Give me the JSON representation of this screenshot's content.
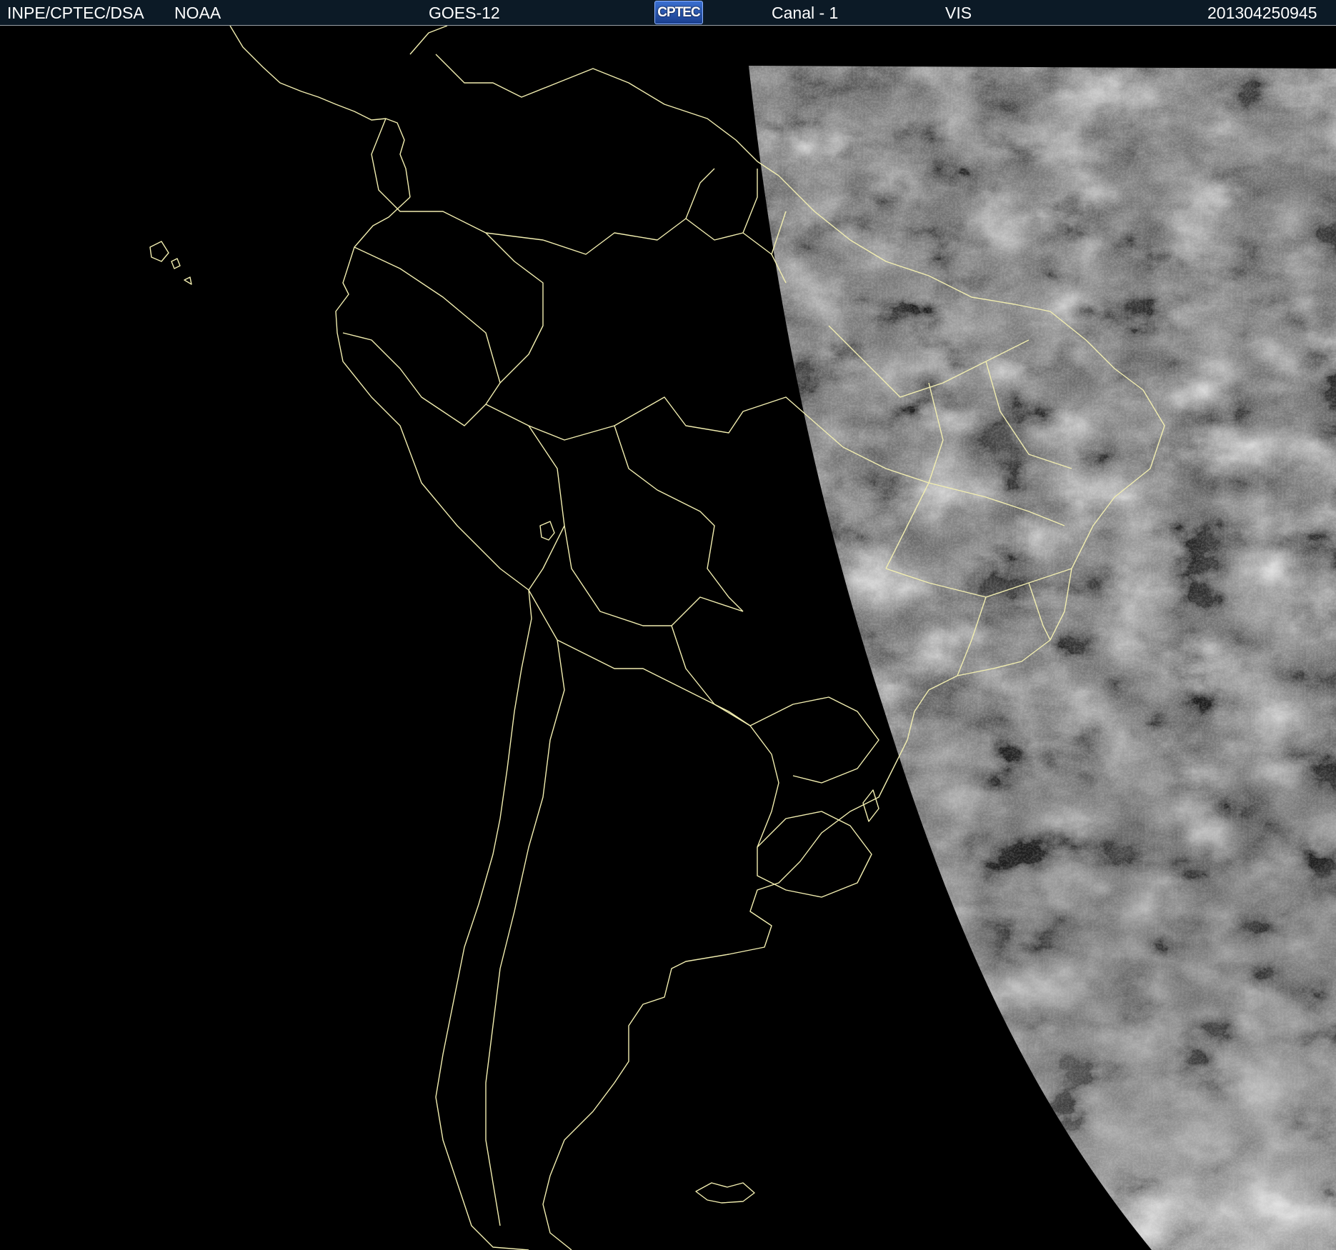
{
  "header": {
    "agency": "INPE/CPTEC/DSA",
    "provider": "NOAA",
    "satellite": "GOES-12",
    "logo_text": "CPTEC",
    "channel": "Canal - 1",
    "band": "VIS",
    "timestamp": "201304250945"
  },
  "colors": {
    "header_bg": "#0c1a26",
    "background": "#000000",
    "boundary_lines": "#f2eeb0",
    "cloud_gray": "#7a7a7a"
  },
  "map": {
    "region": "South America",
    "imagery_type": "visible satellite image, partial disk (day side on the east)"
  }
}
